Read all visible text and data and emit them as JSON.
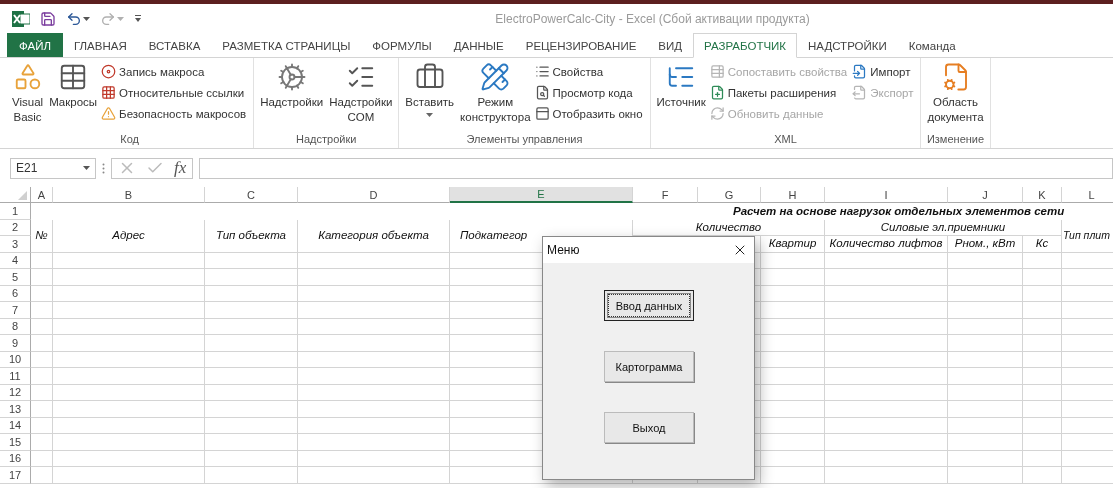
{
  "window": {
    "title": "ElectroPowerCalc-City - Excel (Сбой активации продукта)"
  },
  "quick_access": [
    {
      "kind": "logo"
    },
    {
      "kind": "save"
    },
    {
      "kind": "undo",
      "disabled": false
    },
    {
      "kind": "redo",
      "disabled": true
    },
    {
      "kind": "customize"
    }
  ],
  "tabs": [
    {
      "label": "ФАЙЛ",
      "kind": "file",
      "selected": false
    },
    {
      "label": "ГЛАВНАЯ",
      "kind": "tab",
      "selected": false
    },
    {
      "label": "ВСТАВКА",
      "kind": "tab",
      "selected": false
    },
    {
      "label": "РАЗМЕТКА СТРАНИЦЫ",
      "kind": "tab",
      "selected": false
    },
    {
      "label": "ФОРМУЛЫ",
      "kind": "tab",
      "selected": false
    },
    {
      "label": "ДАННЫЕ",
      "kind": "tab",
      "selected": false
    },
    {
      "label": "РЕЦЕНЗИРОВАНИЕ",
      "kind": "tab",
      "selected": false
    },
    {
      "label": "ВИД",
      "kind": "tab",
      "selected": false
    },
    {
      "label": "РАЗРАБОТЧИК",
      "kind": "tab",
      "selected": true
    },
    {
      "label": "НАДСТРОЙКИ",
      "kind": "tab",
      "selected": false
    },
    {
      "label": "Команда",
      "kind": "tab",
      "selected": false
    }
  ],
  "ribbon": {
    "groups": [
      {
        "label": "Код",
        "items": [
          {
            "kind": "large",
            "label": "Visual Basic"
          },
          {
            "kind": "large",
            "label": "Макросы"
          },
          {
            "kind": "stack",
            "items": [
              {
                "label": "Запись макроса",
                "disabled": false
              },
              {
                "label": "Относительные ссылки",
                "disabled": false
              },
              {
                "label": "Безопасность макросов",
                "disabled": false
              }
            ]
          }
        ]
      },
      {
        "label": "Надстройки",
        "items": [
          {
            "kind": "large",
            "label": "Надстройки"
          },
          {
            "kind": "large",
            "label": "Надстройки COM"
          }
        ]
      },
      {
        "label": "Элементы управления",
        "items": [
          {
            "kind": "large",
            "label": "Вставить",
            "dropdown": true
          },
          {
            "kind": "large",
            "label": "Режим конструктора"
          },
          {
            "kind": "stack",
            "items": [
              {
                "label": "Свойства",
                "disabled": false
              },
              {
                "label": "Просмотр кода",
                "disabled": false
              },
              {
                "label": "Отобразить окно",
                "disabled": false
              }
            ]
          }
        ]
      },
      {
        "label": "XML",
        "items": [
          {
            "kind": "large",
            "label": "Источник"
          },
          {
            "kind": "stack",
            "items": [
              {
                "label": "Сопоставить свойства",
                "disabled": true
              },
              {
                "label": "Пакеты расширения",
                "disabled": false
              },
              {
                "label": "Обновить данные",
                "disabled": true
              }
            ]
          },
          {
            "kind": "stack",
            "items": [
              {
                "label": "Импорт",
                "disabled": false
              },
              {
                "label": "Экспорт",
                "disabled": true
              }
            ]
          }
        ]
      },
      {
        "label": "Изменение",
        "items": [
          {
            "kind": "large",
            "label": "Область документа"
          }
        ]
      }
    ]
  },
  "formula_bar": {
    "name_box": "E21",
    "function_label": "fx"
  },
  "sheet": {
    "columns": [
      {
        "label": "A",
        "selected": false
      },
      {
        "label": "B",
        "selected": false
      },
      {
        "label": "C",
        "selected": false
      },
      {
        "label": "D",
        "selected": false
      },
      {
        "label": "E",
        "selected": true
      },
      {
        "label": "F",
        "selected": false
      },
      {
        "label": "G",
        "selected": false
      },
      {
        "label": "H",
        "selected": false
      },
      {
        "label": "I",
        "selected": false
      },
      {
        "label": "J",
        "selected": false
      },
      {
        "label": "K",
        "selected": false
      },
      {
        "label": "L",
        "selected": false
      }
    ],
    "row_numbers": [
      "1",
      "2",
      "3",
      "4",
      "5",
      "6",
      "7",
      "8",
      "9",
      "10",
      "11",
      "12",
      "13",
      "14",
      "15",
      "16",
      "17"
    ],
    "cells": [
      "Расчет на основе нагрузок отдельных элементов сети",
      "№",
      "Адрес",
      "Тип объекта",
      "Категория объекта",
      "Подкатегор",
      "Количество",
      "Силовые эл.приемники",
      "Тип плит",
      "Квартир",
      "Количество лифтов",
      "Рном., кВт",
      "Кс"
    ]
  },
  "dialog": {
    "title": "Меню",
    "buttons": [
      {
        "label": "Ввод данных",
        "focused": true
      },
      {
        "label": "Картограмма",
        "focused": false
      },
      {
        "label": "Выход",
        "focused": false
      }
    ]
  }
}
